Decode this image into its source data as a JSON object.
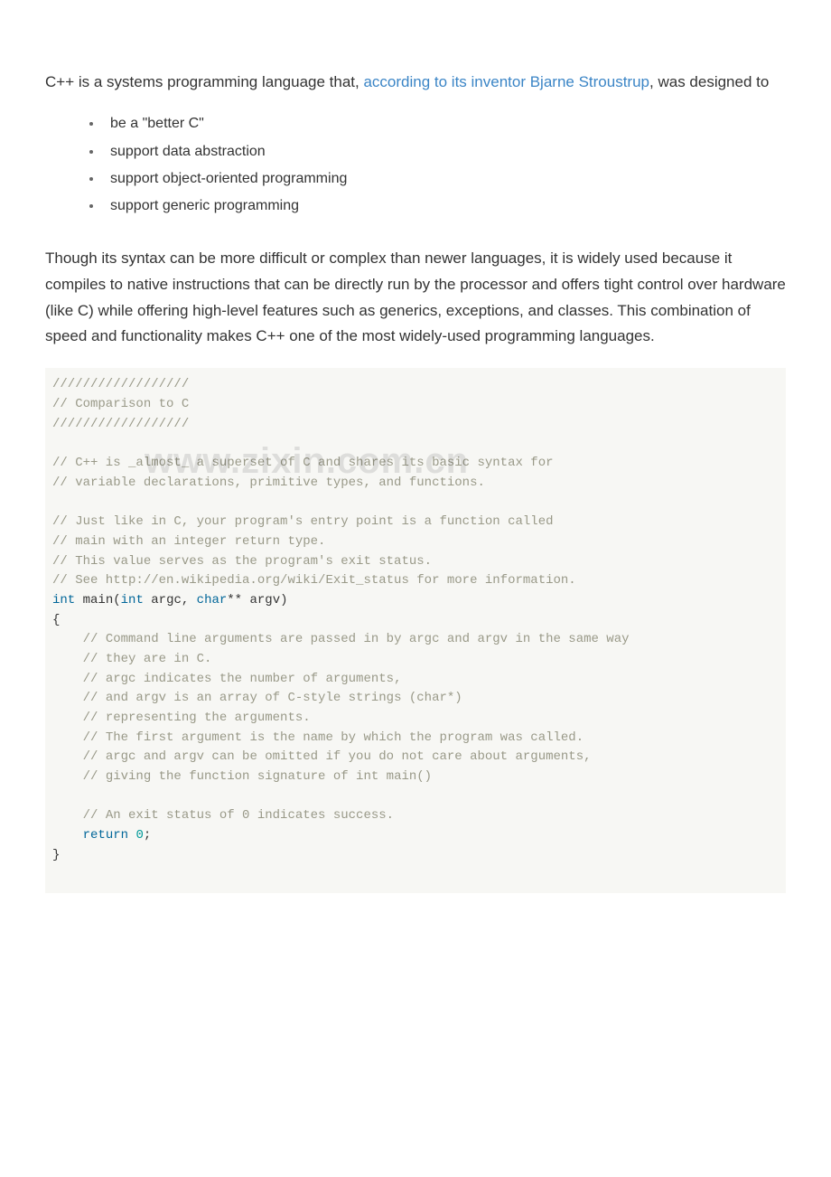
{
  "intro": {
    "pre": "C++ is a systems programming language that, ",
    "link": "according to its inventor Bjarne Stroustrup",
    "post": ", was designed to"
  },
  "bullets": [
    "be a \"better C\"",
    "support data abstraction",
    "support object-oriented programming",
    "support generic programming"
  ],
  "para2": "Though its syntax can be more difficult or complex than newer languages, it is widely used because it compiles to native instructions that can be directly run by the processor and offers tight control over hardware (like C) while offering high-level features such as generics, exceptions, and classes. This combination of speed and functionality makes C++ one of the most widely-used programming languages.",
  "code": {
    "c1": "//////////////////",
    "c2": "// Comparison to C",
    "c3": "//////////////////",
    "c4": "// C++ is _almost_ a superset of C and shares its basic syntax for",
    "c5": "// variable declarations, primitive types, and functions.",
    "c6": "// Just like in C, your program's entry point is a function called",
    "c7": "// main with an integer return type.",
    "c8": "// This value serves as the program's exit status.",
    "c9": "// See http://en.wikipedia.org/wiki/Exit_status for more information.",
    "kw_int1": "int",
    "fn_main": " main(",
    "kw_int2": "int",
    "args1": " argc, ",
    "kw_char": "char",
    "args2": "** argv)",
    "brace_o": "{",
    "c10": "    // Command line arguments are passed in by argc and argv in the same way",
    "c11": "    // they are in C.",
    "c12": "    // argc indicates the number of arguments,",
    "c13": "    // and argv is an array of C-style strings (char*)",
    "c14": "    // representing the arguments.",
    "c15": "    // The first argument is the name by which the program was called.",
    "c16": "    // argc and argv can be omitted if you do not care about arguments,",
    "c17": "    // giving the function signature of int main()",
    "c18": "    // An exit status of 0 indicates success.",
    "indent": "    ",
    "kw_return": "return",
    "sp": " ",
    "num0": "0",
    "semi": ";",
    "brace_c": "}"
  },
  "watermark": "www.zixin.com.cn"
}
